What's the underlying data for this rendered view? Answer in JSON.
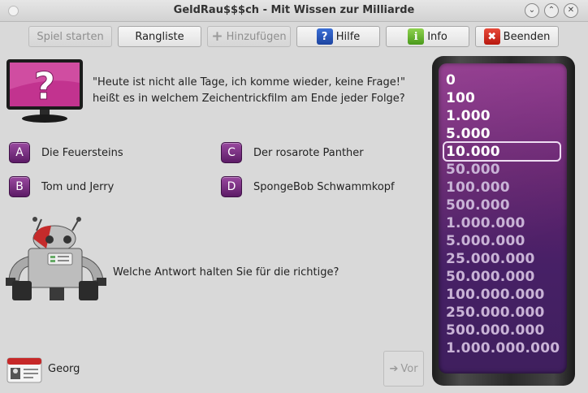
{
  "window": {
    "title": "GeldRau$$$ch - Mit Wissen zur Milliarde"
  },
  "toolbar": {
    "start_label": "Spiel starten",
    "ranking_label": "Rangliste",
    "add_label": "Hinzufügen",
    "help_label": "Hilfe",
    "info_label": "Info",
    "quit_label": "Beenden"
  },
  "question": {
    "text": "\"Heute ist nicht alle Tage, ich komme wieder, keine Frage!\" heißt es in welchem Zeichentrickfilm am Ende jeder Folge?"
  },
  "answers": [
    {
      "letter": "A",
      "text": "Die Feuersteins"
    },
    {
      "letter": "B",
      "text": "Tom und Jerry"
    },
    {
      "letter": "C",
      "text": "Der rosarote Panther"
    },
    {
      "letter": "D",
      "text": "SpongeBob Schwammkopf"
    }
  ],
  "prompt": "Welche Antwort halten Sie für die richtige?",
  "player": {
    "name": "Georg"
  },
  "next_button": {
    "label": "Vor"
  },
  "ladder": {
    "current_index": 4,
    "steps": [
      "0",
      "100",
      "1.000",
      "5.000",
      "10.000",
      "50.000",
      "100.000",
      "500.000",
      "1.000.000",
      "5.000.000",
      "25.000.000",
      "50.000.000",
      "100.000.000",
      "250.000.000",
      "500.000.000",
      "1.000.000.000"
    ]
  },
  "colors": {
    "ladder_reached": "#ffffff",
    "ladder_open": "#c9b3d6",
    "answer_badge": "#7a3382"
  },
  "icons": {
    "help": "question-icon",
    "info": "info-icon",
    "quit": "close-icon",
    "add": "plus-icon",
    "next": "arrow-right-icon"
  }
}
